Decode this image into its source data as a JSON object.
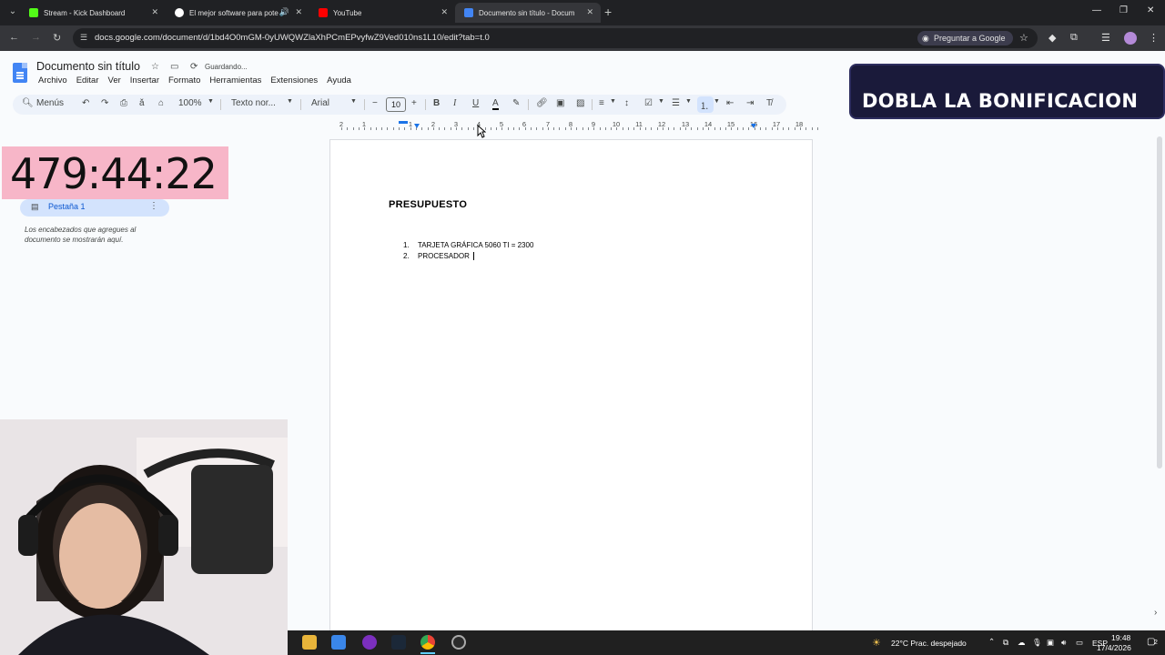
{
  "browser": {
    "tabs": [
      {
        "title": "Stream - Kick Dashboard",
        "favicon_color": "#53fc18"
      },
      {
        "title": "El mejor software para pote",
        "favicon_color": "#ffffff"
      },
      {
        "title": "YouTube",
        "favicon_color": "#ff0000"
      },
      {
        "title": "Documento sin título - Docum",
        "favicon_color": "#4285f4"
      }
    ],
    "url": "docs.google.com/document/d/1bd4O0mGM-0yUWQWZlaXhPCmEPvyfwZ9Ved010ns1L10/edit?tab=t.0",
    "ask_google_label": "Preguntar a Google"
  },
  "docs": {
    "title": "Documento sin título",
    "save_status": "Guardando...",
    "menu": [
      "Archivo",
      "Editar",
      "Ver",
      "Insertar",
      "Formato",
      "Herramientas",
      "Extensiones",
      "Ayuda"
    ],
    "toolbar": {
      "menus_label": "Menús",
      "zoom": "100%",
      "style": "Texto nor...",
      "font": "Arial",
      "font_size": "10"
    },
    "ruler_numbers": [
      "2",
      "1",
      "1",
      "2",
      "3",
      "4",
      "5",
      "6",
      "7",
      "8",
      "9",
      "10",
      "11",
      "12",
      "13",
      "14",
      "15",
      "16",
      "17",
      "18"
    ],
    "outline": {
      "tab_label": "Pestaña 1",
      "hint": "Los encabezados que agregues al documento se mostrarán aquí."
    },
    "content": {
      "heading": "PRESUPUESTO",
      "items": [
        {
          "num": "1.",
          "text": "TARJETA GRÁFICA 5060 TI = 2300"
        },
        {
          "num": "2.",
          "text": "PROCESADOR "
        }
      ]
    }
  },
  "overlay": {
    "timer": "479:44:22",
    "promo": "DOBLA LA BONIFICACION"
  },
  "taskbar": {
    "weather": "22°C  Prac. despejado",
    "language": "ESP",
    "time": "19:48",
    "date": "17/4/2026",
    "notifications": "2"
  }
}
